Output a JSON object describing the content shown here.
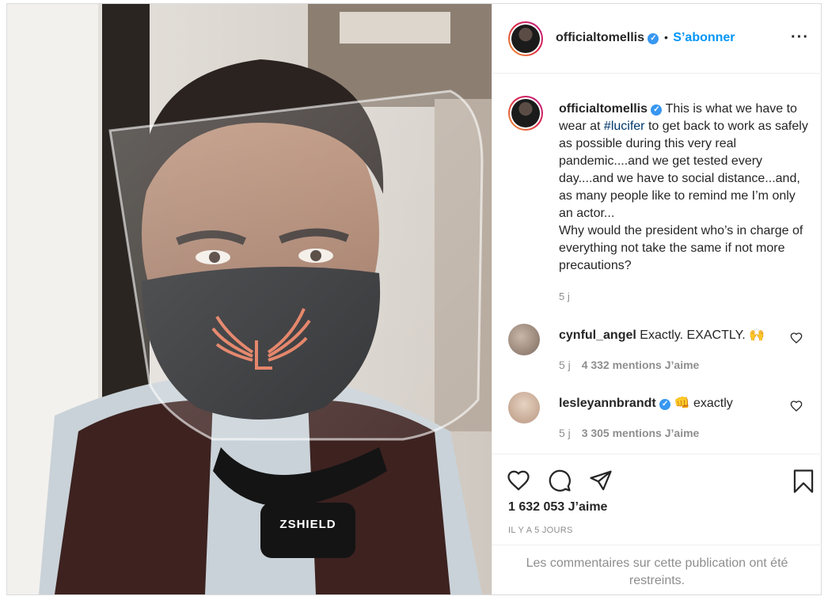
{
  "post": {
    "image_alt": "Man wearing a black face mask and a clear face shield",
    "mask_brand_text": "ZSHIELD",
    "author": "officialtomellis",
    "follow_label": "S’abonner",
    "more_icon": "more-horizontal-icon"
  },
  "caption": {
    "username": "officialtomellis",
    "text_before": "This is what we have to wear at ",
    "hashtag": "#lucifer",
    "text_after": " to get back to work as safely as possible during this very real pandemic....and we get tested every day....and we have to social distance...and, as many people like to remind me I’m only an actor...",
    "text_line2": "Why would the president who’s in charge of everything not take the same if not more precautions?",
    "time": "5 j"
  },
  "comments": [
    {
      "username": "cynful_angel",
      "text": "Exactly. EXACTLY.",
      "emoji": "🙌",
      "time": "5 j",
      "likes": "4 332 mentions J’aime"
    },
    {
      "username": "lesleyannbrandt",
      "text": "exactly",
      "emoji": "👊",
      "time": "5 j",
      "likes": "3 305 mentions J’aime"
    }
  ],
  "actions": {
    "likes": "1 632 053 J’aime",
    "ago": "IL Y A 5 JOURS",
    "restricted": "Les commentaires sur cette publication ont été restreints."
  },
  "colors": {
    "accent": "#0095f6",
    "verified": "#3897f0",
    "muted": "#8e8e8e"
  }
}
